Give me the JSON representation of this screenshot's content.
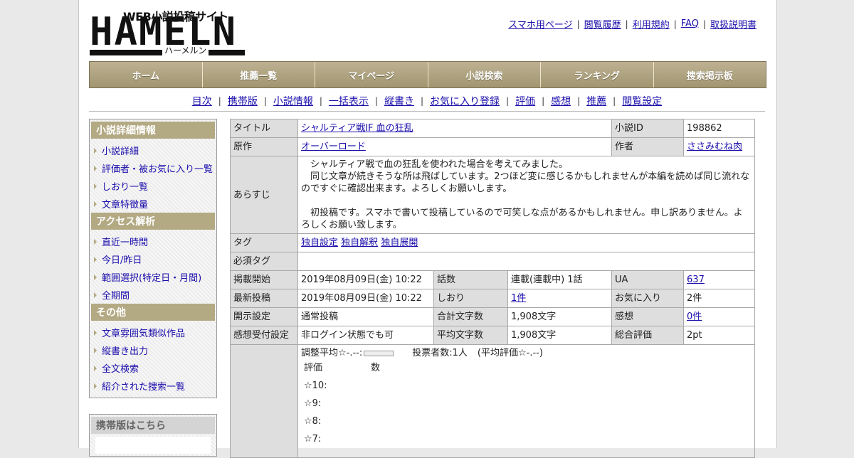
{
  "logo": {
    "sub": "WEB小説投稿サイト",
    "main": "HAMELN",
    "kana": "ハーメルン"
  },
  "top_links": [
    "スマホ用ページ",
    "閲覧履歴",
    "利用規約",
    "FAQ",
    "取扱説明書"
  ],
  "main_nav": [
    "ホーム",
    "推薦一覧",
    "マイページ",
    "小説検索",
    "ランキング",
    "捜索掲示板"
  ],
  "sub_nav": [
    "目次",
    "携帯版",
    "小説情報",
    "一括表示",
    "縦書き",
    "お気に入り登録",
    "評価",
    "感想",
    "推薦",
    "閲覧設定"
  ],
  "sidebar": {
    "section1": {
      "title": "小説詳細情報",
      "items": [
        "小説詳細",
        "評価者・被お気に入り一覧",
        "しおり一覧",
        "文章特徴量"
      ]
    },
    "section2": {
      "title": "アクセス解析",
      "items": [
        "直近一時間",
        "今日/昨日",
        "範囲選択(特定日・月間)",
        "全期間"
      ]
    },
    "section3": {
      "title": "その他",
      "items": [
        "文章雰囲気類似作品",
        "縦書き出力",
        "全文検索",
        "紹介された捜索一覧"
      ]
    },
    "mobile": {
      "title": "携帯版はこちら"
    }
  },
  "info": {
    "title_label": "タイトル",
    "title": "シャルティア戦IF 血の狂乱",
    "id_label": "小説ID",
    "id": "198862",
    "original_label": "原作",
    "original": "オーバーロード",
    "author_label": "作者",
    "author": "ささみむね肉",
    "synopsis_label": "あらすじ",
    "synopsis": "　シャルティア戦で血の狂乱を使われた場合を考えてみました。\n　同じ文章が続きそうな所は飛ばしています。2つほど変に感じるかもしれませんが本編を読めば同じ流れなのですぐに確認出来ます。よろしくお願いします。\n\n　初投稿です。スマホで書いて投稿しているので可笑しな点があるかもしれません。申し訳ありません。よろしくお願い致します。",
    "tag_label": "タグ",
    "tags": [
      "独自設定",
      "独自解釈",
      "独自展開"
    ],
    "required_tag_label": "必須タグ",
    "rows": [
      {
        "l1": "掲載開始",
        "v1": "2019年08月09日(金) 10:22",
        "l2": "話数",
        "v2": "連載(連載中) 1話",
        "l3": "UA",
        "v3": "637",
        "link2": false,
        "link3": true
      },
      {
        "l1": "最新投稿",
        "v1": "2019年08月09日(金) 10:22",
        "l2": "しおり",
        "v2": "1件",
        "l3": "お気に入り",
        "v3": "2件",
        "link2": true,
        "link3": false
      },
      {
        "l1": "開示設定",
        "v1": "通常投稿",
        "l2": "合計文字数",
        "v2": "1,908文字",
        "l3": "感想",
        "v3": "0件",
        "link2": false,
        "link3": true
      },
      {
        "l1": "感想受付設定",
        "v1": "非ログイン状態でも可",
        "l2": "平均文字数",
        "v2": "1,908文字",
        "l3": "総合評価",
        "v3": "2pt",
        "link2": false,
        "link3": false
      }
    ],
    "rating": {
      "avg": "調整平均☆-.--:",
      "voters": "投票者数:1人",
      "avg_paren": "(平均評価☆-.--)",
      "col1": "評価",
      "col2": "数",
      "levels": [
        "☆10:",
        "☆9:",
        "☆8:",
        "☆7:"
      ]
    }
  }
}
